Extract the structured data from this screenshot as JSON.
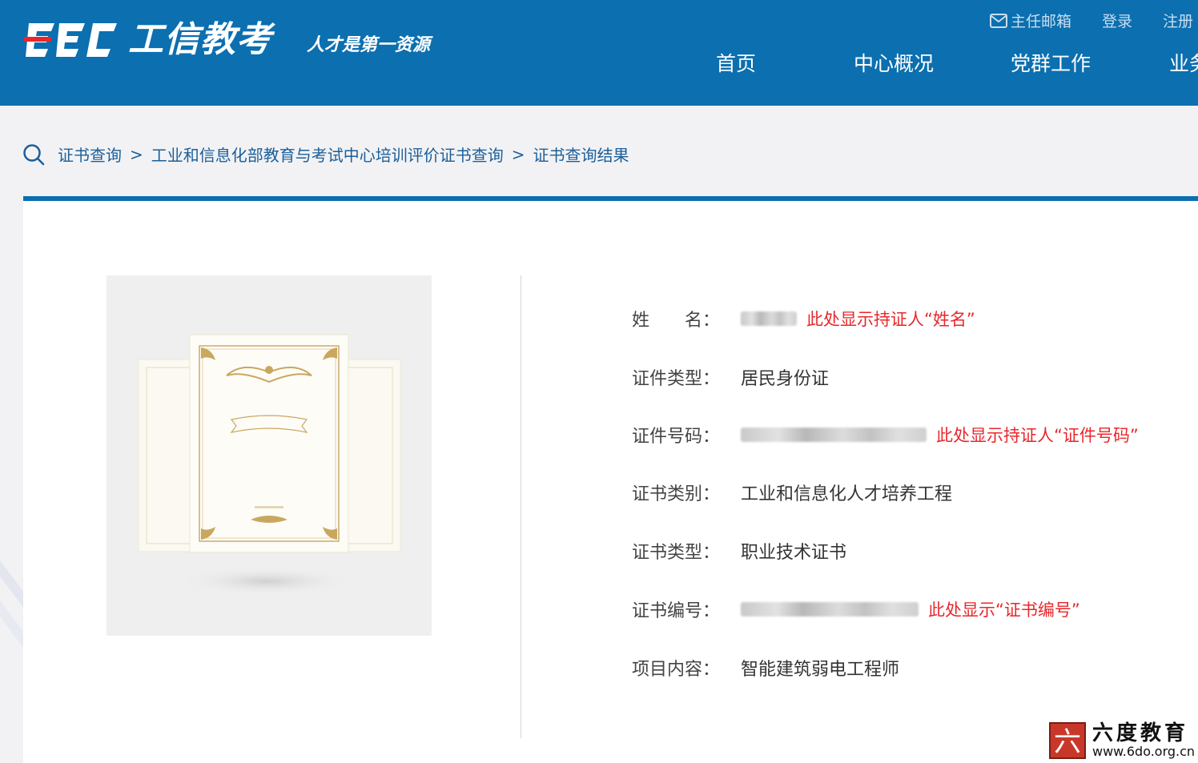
{
  "header": {
    "logo_cec": "CEC",
    "logo_text": "工信教考",
    "slogan": "人才是第一资源",
    "top_links": [
      "主任邮箱",
      "登录",
      "注册"
    ],
    "nav": [
      "首页",
      "中心概况",
      "党群工作",
      "业务"
    ]
  },
  "breadcrumb": {
    "items": [
      "证书查询",
      "工业和信息化部教育与考试中心培训评价证书查询",
      "证书查询结果"
    ]
  },
  "certificate": {
    "fields": [
      {
        "label": "姓　　名：",
        "value": "",
        "note": "此处显示持证人“姓名”",
        "redacted": true
      },
      {
        "label": "证件类型：",
        "value": "居民身份证",
        "note": "",
        "redacted": false
      },
      {
        "label": "证件号码：",
        "value": "",
        "note": "此处显示持证人“证件号码”",
        "redacted": true
      },
      {
        "label": "证书类别：",
        "value": "工业和信息化人才培养工程",
        "note": "",
        "redacted": false
      },
      {
        "label": "证书类型：",
        "value": "职业技术证书",
        "note": "",
        "redacted": false
      },
      {
        "label": "证书编号：",
        "value": "",
        "note": "此处显示“证书编号”",
        "redacted": true
      },
      {
        "label": "项目内容：",
        "value": "智能建筑弱电工程师",
        "note": "",
        "redacted": false
      }
    ]
  },
  "watermark": {
    "seal_char": "六",
    "name": "六度教育",
    "url": "www.6do.org.cn"
  },
  "colors": {
    "header_bg": "#0b6fb0",
    "note_red": "#e8272c",
    "link_blue": "#1b5f9a"
  }
}
